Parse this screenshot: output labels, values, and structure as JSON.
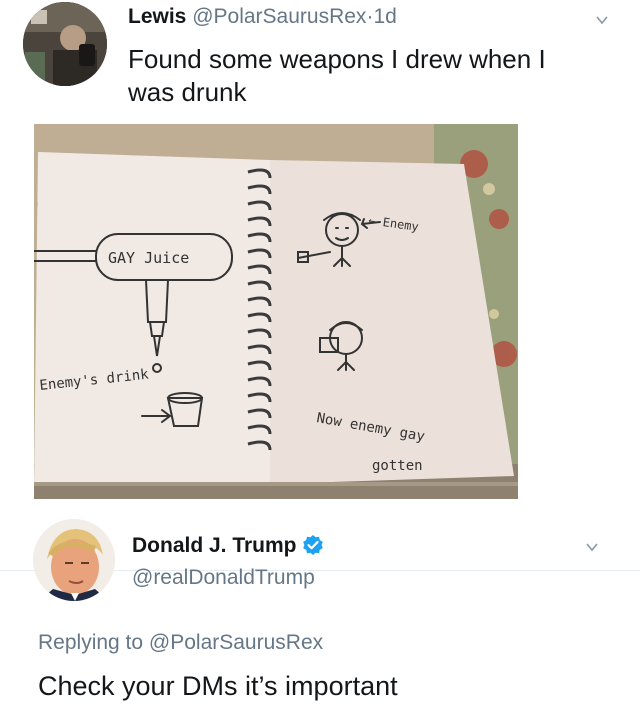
{
  "tweet1": {
    "author_name": "Lewis",
    "author_handle": "@PolarSaurusRex",
    "separator": "·",
    "time": "1d",
    "text": "Found some weapons I drew when I was drunk",
    "image": {
      "labels": {
        "juice": "GAY Juice",
        "enemy": "← Enemy",
        "drink": "Enemy's drink",
        "gay": "Now enemy gay",
        "gotten": "gotten"
      }
    }
  },
  "tweet2": {
    "author_name": "Donald J. Trump",
    "author_handle": "@realDonaldTrump",
    "replying_prefix": "Replying to",
    "replying_to": "@PolarSaurusRex",
    "text": "Check your DMs it’s important"
  },
  "icons": {
    "menu": "chevron-down-icon",
    "verified": "verified-badge-icon"
  },
  "colors": {
    "text": "#14171a",
    "secondary": "#657786",
    "verified": "#1da1f2"
  }
}
